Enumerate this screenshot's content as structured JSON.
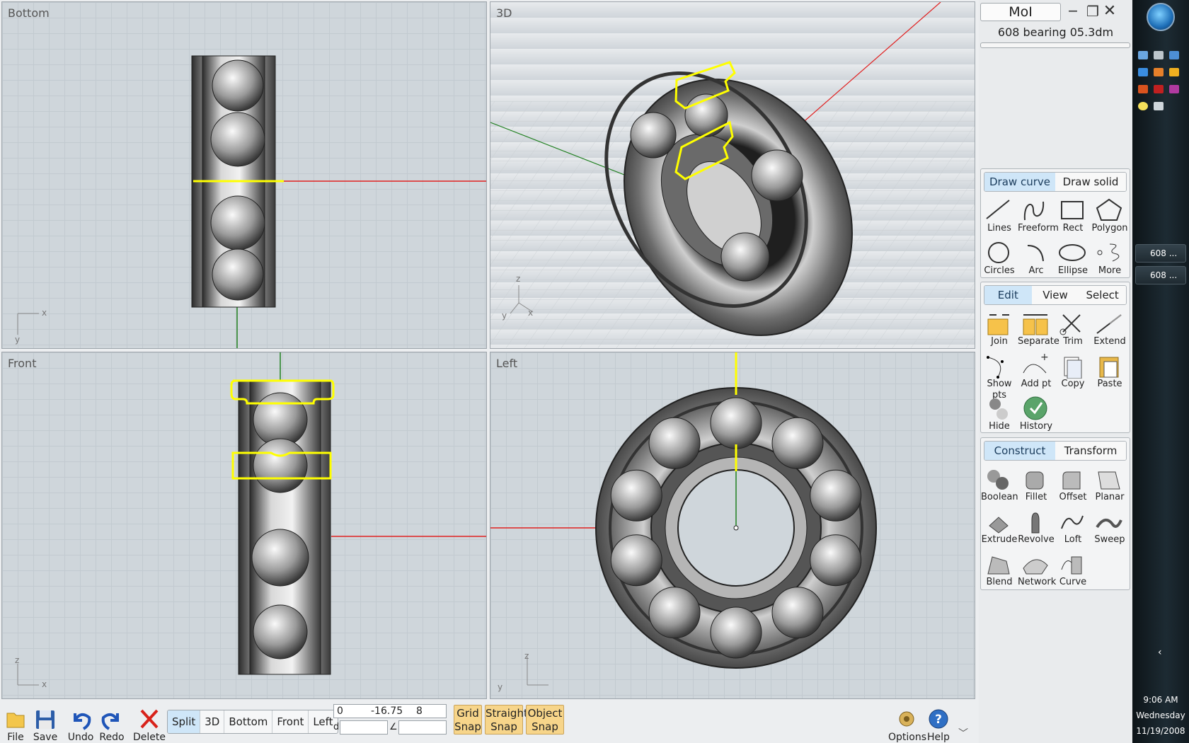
{
  "app": {
    "title": "MoI",
    "filename": "608 bearing 05.3dm",
    "window_buttons": [
      "minimize-icon",
      "restore-icon",
      "close-icon"
    ]
  },
  "viewports": {
    "bottom": "Bottom",
    "three_d": "3D",
    "front": "Front",
    "left": "Left"
  },
  "axes": {
    "x": "x",
    "y": "y",
    "z": "z"
  },
  "draw_panel": {
    "tabs": [
      "Draw curve",
      "Draw solid"
    ],
    "active_tab": "Draw curve",
    "tools": [
      {
        "label": "Lines",
        "icon": "line-icon"
      },
      {
        "label": "Freeform",
        "icon": "freeform-icon"
      },
      {
        "label": "Rect",
        "icon": "rect-icon"
      },
      {
        "label": "Polygon",
        "icon": "polygon-icon"
      },
      {
        "label": "Circles",
        "icon": "circle-icon"
      },
      {
        "label": "Arc",
        "icon": "arc-icon"
      },
      {
        "label": "Ellipse",
        "icon": "ellipse-icon"
      },
      {
        "label": "More",
        "icon": "more-icon"
      }
    ]
  },
  "edit_panel": {
    "tabs": [
      "Edit",
      "View",
      "Select"
    ],
    "active_tab": "Edit",
    "tools": [
      {
        "label": "Join",
        "icon": "join-icon"
      },
      {
        "label": "Separate",
        "icon": "separate-icon"
      },
      {
        "label": "Trim",
        "icon": "scissors-icon"
      },
      {
        "label": "Extend",
        "icon": "extend-icon"
      },
      {
        "label": "Show pts",
        "icon": "show-points-icon"
      },
      {
        "label": "Add pt",
        "icon": "add-point-icon"
      },
      {
        "label": "Copy",
        "icon": "copy-icon"
      },
      {
        "label": "Paste",
        "icon": "paste-icon"
      },
      {
        "label": "Hide",
        "icon": "hide-icon"
      },
      {
        "label": "History",
        "icon": "history-icon"
      }
    ]
  },
  "construct_panel": {
    "tabs": [
      "Construct",
      "Transform"
    ],
    "active_tab": "Construct",
    "tools": [
      {
        "label": "Boolean",
        "icon": "boolean-icon"
      },
      {
        "label": "Fillet",
        "icon": "fillet-icon"
      },
      {
        "label": "Offset",
        "icon": "offset-icon"
      },
      {
        "label": "Planar",
        "icon": "planar-icon"
      },
      {
        "label": "Extrude",
        "icon": "extrude-icon"
      },
      {
        "label": "Revolve",
        "icon": "revolve-icon"
      },
      {
        "label": "Loft",
        "icon": "loft-icon"
      },
      {
        "label": "Sweep",
        "icon": "sweep-icon"
      },
      {
        "label": "Blend",
        "icon": "blend-icon"
      },
      {
        "label": "Network",
        "icon": "network-icon"
      },
      {
        "label": "Curve",
        "icon": "curve-icon"
      }
    ]
  },
  "bottom_bar": {
    "file": "File",
    "save": "Save",
    "undo": "Undo",
    "redo": "Redo",
    "delete": "Delete",
    "view_tabs": [
      "Split",
      "3D",
      "Bottom",
      "Front",
      "Left"
    ],
    "active_view": "Split",
    "coord_x": "0",
    "coord_y": "-16.75",
    "coord_z": "8",
    "distance_label": "d",
    "angle_label": "∠",
    "grid_snap": [
      "Grid",
      "Snap"
    ],
    "straight_snap": [
      "Straight",
      "Snap"
    ],
    "object_snap": [
      "Object",
      "Snap"
    ],
    "options": "Options",
    "help": "Help"
  },
  "taskbar": {
    "items": [
      "608 ...",
      "608 ..."
    ],
    "time": "9:06 AM",
    "day": "Wednesday",
    "date": "11/19/2008"
  },
  "colors": {
    "accent": "#cfe6f8",
    "snap": "#f7d58a",
    "selection": "#ffff00",
    "x_axis": "#e02020",
    "y_axis": "#208020"
  }
}
